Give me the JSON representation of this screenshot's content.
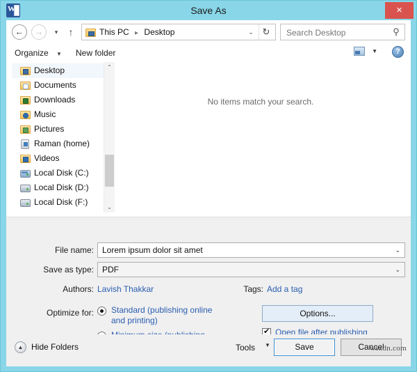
{
  "window": {
    "title": "Save As",
    "app_icon": "word-icon",
    "app_icon_letter": "W",
    "close_label": "×",
    "titlebar_color": "#88d6e8",
    "close_button_color": "#d9534f"
  },
  "nav": {
    "back_glyph": "←",
    "forward_glyph": "→",
    "recent_glyph": "▾",
    "up_glyph": "↑",
    "breadcrumbs": [
      "This PC",
      "Desktop"
    ],
    "breadcrumb_separator": "▸",
    "dropdown_glyph": "⌄",
    "refresh_glyph": "↻"
  },
  "search": {
    "placeholder": "Search Desktop",
    "value": "",
    "icon": "search-icon",
    "icon_glyph": "⚲"
  },
  "toolbar": {
    "organize_label": "Organize",
    "organize_caret": "▼",
    "new_folder_label": "New folder",
    "view_icon": "view-layout-icon",
    "view_caret": "▼",
    "help_icon": "help-icon",
    "help_glyph": "?"
  },
  "tree": {
    "items": [
      {
        "label": "Desktop",
        "icon": "desktop-folder-icon",
        "selected": true
      },
      {
        "label": "Documents",
        "icon": "documents-folder-icon",
        "selected": false
      },
      {
        "label": "Downloads",
        "icon": "downloads-folder-icon",
        "selected": false
      },
      {
        "label": "Music",
        "icon": "music-folder-icon",
        "selected": false
      },
      {
        "label": "Pictures",
        "icon": "pictures-folder-icon",
        "selected": false
      },
      {
        "label": "Raman (home)",
        "icon": "home-user-icon",
        "selected": false
      },
      {
        "label": "Videos",
        "icon": "videos-folder-icon",
        "selected": false
      },
      {
        "label": "Local Disk (C:)",
        "icon": "system-drive-icon",
        "selected": false
      },
      {
        "label": "Local Disk (D:)",
        "icon": "drive-icon",
        "selected": false
      },
      {
        "label": "Local Disk (F:)",
        "icon": "drive-icon",
        "selected": false
      }
    ],
    "scrollbar": {
      "up_glyph": "⌃",
      "down_glyph": "⌄"
    }
  },
  "file_list": {
    "empty_message": "No items match your search."
  },
  "form": {
    "file_name_label": "File name:",
    "file_name_value": "Lorem ipsum dolor sit amet",
    "save_as_type_label": "Save as type:",
    "save_as_type_value": "PDF",
    "combo_caret": "⌄",
    "authors_label": "Authors:",
    "authors_value": "Lavish Thakkar",
    "tags_label": "Tags:",
    "tags_value": "Add a tag",
    "link_color": "#2a5db0",
    "optimize_label": "Optimize for:",
    "radios": [
      {
        "label": "Standard (publishing online and printing)",
        "selected": true
      },
      {
        "label": "Minimum size (publishing online)",
        "selected": false
      }
    ],
    "options_button_label": "Options...",
    "open_after_publishing_label": "Open file after publishing",
    "open_after_publishing_checked": true
  },
  "footer": {
    "hide_folders_label": "Hide Folders",
    "hide_folders_glyph": "▲",
    "tools_label": "Tools",
    "tools_caret": "▼",
    "save_label": "Save",
    "cancel_label": "Cancel"
  },
  "watermark": {
    "text": "wsxdn.com"
  }
}
